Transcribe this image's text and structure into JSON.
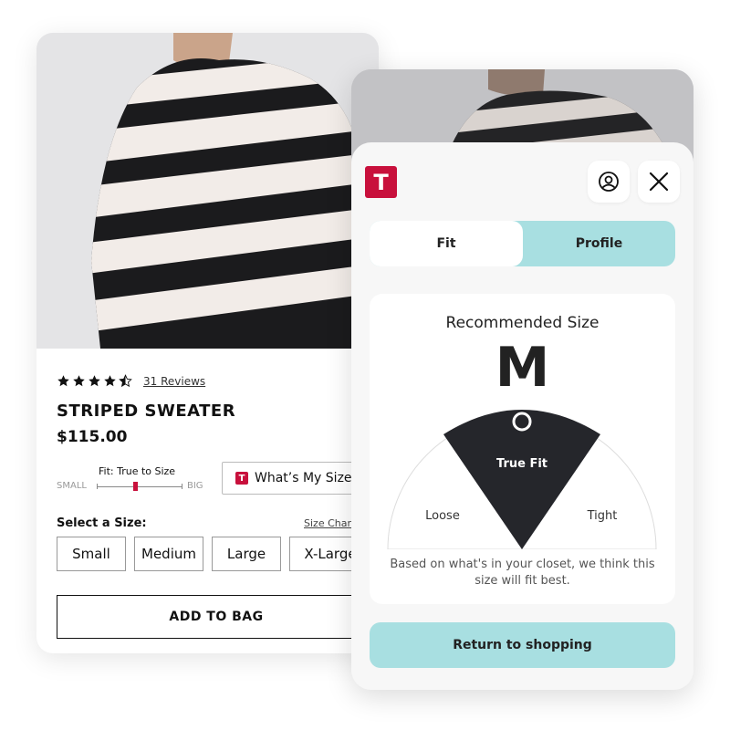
{
  "product": {
    "reviews": "31 Reviews",
    "rating": 4.5,
    "title": "STRIPED SWEATER",
    "price": "$115.00",
    "fit_label": "Fit: True to Size",
    "fit_small": "SMALL",
    "fit_big": "BIG",
    "fit_level": 0.45,
    "whats_my_size": "What’s My Size?",
    "select_size_label": "Select a Size:",
    "size_chart": "Size Chart",
    "sizes": [
      "Small",
      "Medium",
      "Large",
      "X-Large"
    ],
    "add_to_bag": "ADD TO BAG"
  },
  "modal": {
    "brand_logo_letter": "T",
    "profile_icon": "user-circle-icon",
    "close_icon": "close-icon",
    "tabs": [
      {
        "label": "Fit",
        "active": true
      },
      {
        "label": "Profile",
        "active": false
      }
    ],
    "recommended_title": "Recommended Size",
    "recommended_size": "M",
    "gauge": {
      "left_label": "Loose",
      "center_label": "True Fit",
      "right_label": "Tight"
    },
    "note": "Based on what's in your closet, we think this size will fit best.",
    "return_button": "Return to shopping"
  },
  "colors": {
    "brand_red": "#c8103c",
    "accent_teal": "#a8dfe1",
    "dark": "#25262b"
  }
}
